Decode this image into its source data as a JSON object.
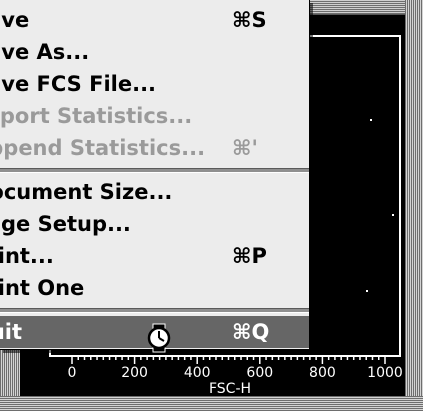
{
  "menu": {
    "items": [
      {
        "label": "Save",
        "shortcut": "⌘S",
        "enabled": true
      },
      {
        "label": "Save As...",
        "shortcut": "",
        "enabled": true
      },
      {
        "label": "Save FCS File...",
        "shortcut": "",
        "enabled": true
      },
      {
        "label": "Export Statistics...",
        "shortcut": "",
        "enabled": false
      },
      {
        "label": "Append Statistics...",
        "shortcut": "⌘'",
        "enabled": false
      },
      {
        "label": "Document Size...",
        "shortcut": "",
        "enabled": true
      },
      {
        "label": "Page Setup...",
        "shortcut": "",
        "enabled": true
      },
      {
        "label": "Print...",
        "shortcut": "⌘P",
        "enabled": true
      },
      {
        "label": "Print One",
        "shortcut": "",
        "enabled": true
      },
      {
        "label": "Quit",
        "shortcut": "⌘Q",
        "enabled": true,
        "highlighted": true
      }
    ]
  },
  "plot": {
    "x_axis_label": "FSC-H",
    "x_ticks": [
      "0",
      "200",
      "400",
      "600",
      "800",
      "1000"
    ]
  },
  "cursor": {
    "icon": "wristwatch-busy-icon"
  }
}
